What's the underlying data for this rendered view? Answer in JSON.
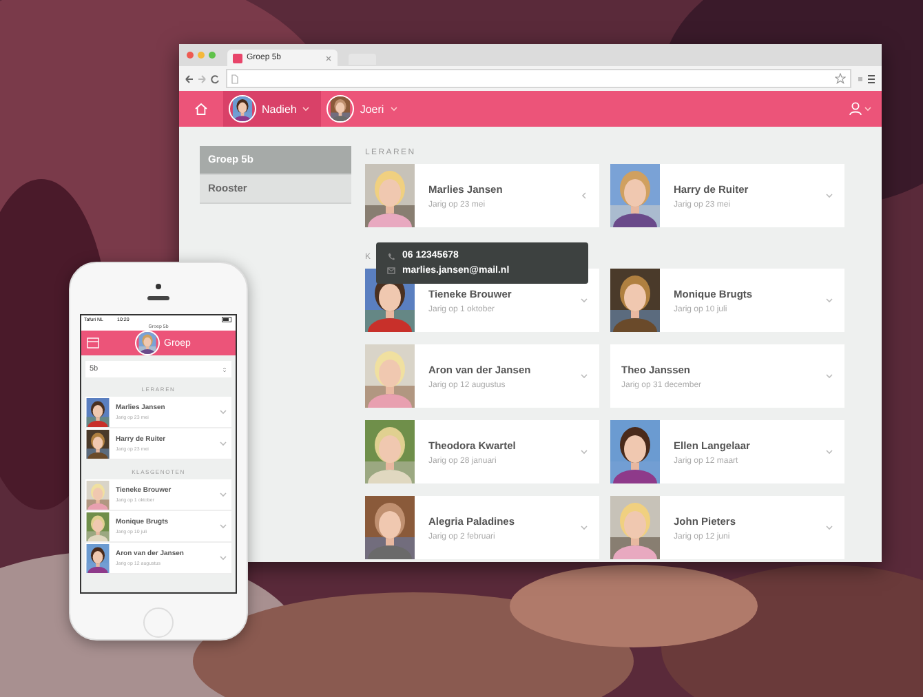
{
  "browser": {
    "tab_title": "Groep 5b",
    "nav": {
      "users": [
        {
          "name": "Nadieh",
          "selected": true
        },
        {
          "name": "Joeri",
          "selected": false
        }
      ]
    },
    "sidebar": {
      "items": [
        {
          "label": "Groep 5b",
          "selected": true
        },
        {
          "label": "Rooster",
          "selected": false
        }
      ]
    },
    "sections": [
      {
        "heading": "LERAREN",
        "people": [
          {
            "name": "Marlies Jansen",
            "birthday": "Jarig op 23 mei",
            "has_photo": true,
            "expanded": true
          },
          {
            "name": "Harry de Ruiter",
            "birthday": "Jarig op 23 mei",
            "has_photo": true,
            "expanded": false
          }
        ]
      },
      {
        "heading": "K",
        "people": [
          {
            "name": "Tieneke Brouwer",
            "birthday": "Jarig op 1 oktober",
            "has_photo": true,
            "expanded": false
          },
          {
            "name": "Monique Brugts",
            "birthday": "Jarig op 10 juli",
            "has_photo": true,
            "expanded": false
          },
          {
            "name": "Aron van der Jansen",
            "birthday": "Jarig op 12 augustus",
            "has_photo": true,
            "expanded": false
          },
          {
            "name": "Theo Janssen",
            "birthday": "Jarig op 31 december",
            "has_photo": false,
            "expanded": false
          },
          {
            "name": "Theodora Kwartel",
            "birthday": "Jarig op 28 januari",
            "has_photo": true,
            "expanded": false
          },
          {
            "name": "Ellen Langelaar",
            "birthday": "Jarig op 12 maart",
            "has_photo": true,
            "expanded": false
          },
          {
            "name": "Alegria Paladines",
            "birthday": "Jarig op 2 februari",
            "has_photo": true,
            "expanded": false
          },
          {
            "name": "John Pieters",
            "birthday": "Jarig op 12 juni",
            "has_photo": true,
            "expanded": false
          }
        ]
      }
    ],
    "tooltip": {
      "phone": "06 12345678",
      "email": "marlies.jansen@mail.nl"
    }
  },
  "phone": {
    "carrier": "Tafuri NL",
    "time": "10:20",
    "page_title": "Groep 5b",
    "header_title": "Groep",
    "select_value": "5b",
    "sections": [
      {
        "heading": "LERAREN",
        "people": [
          {
            "name": "Marlies Jansen",
            "birthday": "Jarig op 23 mei"
          },
          {
            "name": "Harry de Ruiter",
            "birthday": "Jarig op 23 mei"
          }
        ]
      },
      {
        "heading": "KLASGENOTEN",
        "people": [
          {
            "name": "Tieneke Brouwer",
            "birthday": "Jarig op 1 oktober"
          },
          {
            "name": "Monique Brugts",
            "birthday": "Jarig op 10 juli"
          },
          {
            "name": "Aron van der Jansen",
            "birthday": "Jarig op 12 augustus"
          }
        ]
      }
    ]
  }
}
